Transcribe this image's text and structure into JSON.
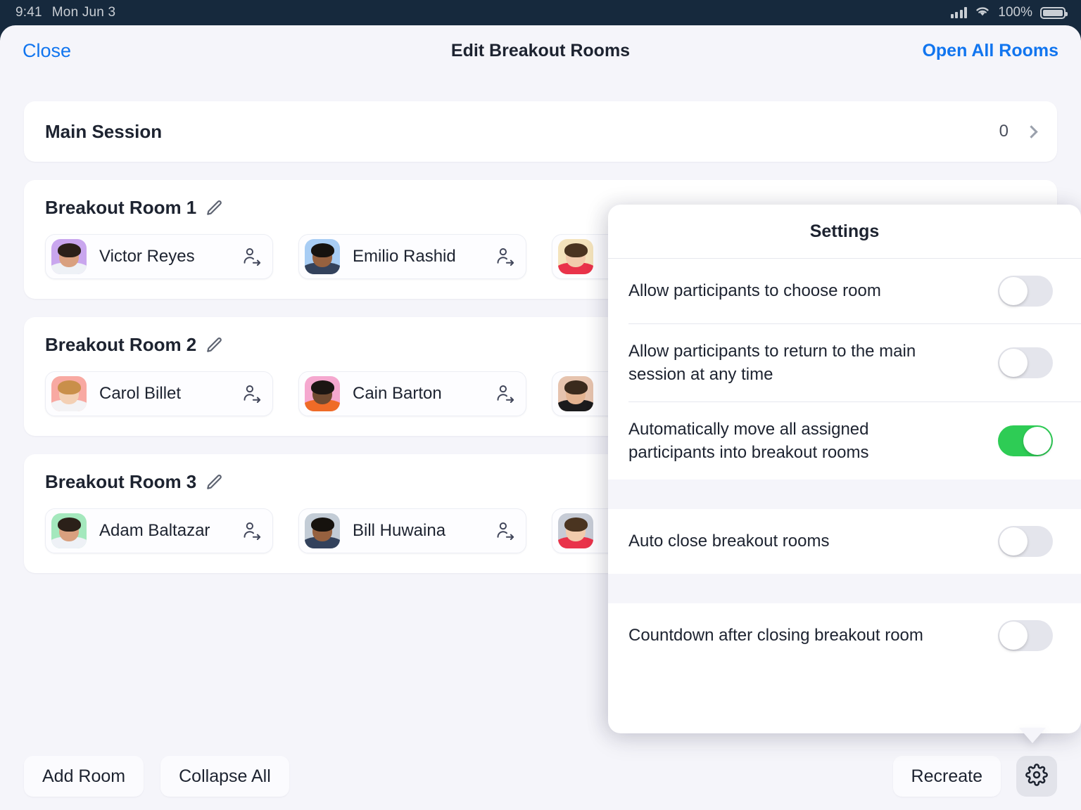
{
  "status_bar": {
    "time": "9:41",
    "date": "Mon Jun 3",
    "battery_text": "100%",
    "signal_icon": "cellular-signal-icon",
    "wifi_icon": "wifi-icon",
    "battery_icon": "battery-icon"
  },
  "nav": {
    "close_label": "Close",
    "title": "Edit Breakout Rooms",
    "action_label": "Open All Rooms"
  },
  "main_session": {
    "title": "Main Session",
    "count": "0",
    "chevron_icon": "chevron-right-icon"
  },
  "rooms": [
    {
      "title": "Breakout Room 1",
      "edit_icon": "pencil-icon",
      "participants": [
        {
          "name": "Victor Reyes",
          "avatar_bg": "#c9a6ee",
          "move_icon": "move-participant-icon"
        },
        {
          "name": "Emilio Rashid",
          "avatar_bg": "#a8cdf4",
          "move_icon": "move-participant-icon"
        },
        {
          "name": "",
          "avatar_bg": "#f4e3bc",
          "move_icon": "move-participant-icon"
        }
      ]
    },
    {
      "title": "Breakout Room 2",
      "edit_icon": "pencil-icon",
      "participants": [
        {
          "name": "Carol Billet",
          "avatar_bg": "#f8a9a2",
          "move_icon": "move-participant-icon"
        },
        {
          "name": "Cain Barton",
          "avatar_bg": "#f5a8cf",
          "move_icon": "move-participant-icon"
        },
        {
          "name": "",
          "avatar_bg": "#e6c3ae",
          "move_icon": "move-participant-icon"
        }
      ]
    },
    {
      "title": "Breakout Room 3",
      "edit_icon": "pencil-icon",
      "participants": [
        {
          "name": "Adam Baltazar",
          "avatar_bg": "#a4e8bd",
          "move_icon": "move-participant-icon"
        },
        {
          "name": "Bill Huwaina",
          "avatar_bg": "#c3ccd6",
          "move_icon": "move-participant-icon"
        },
        {
          "name": "",
          "avatar_bg": "#c7ccd6",
          "move_icon": "move-participant-icon"
        }
      ]
    }
  ],
  "toolbar": {
    "add_room_label": "Add Room",
    "collapse_all_label": "Collapse All",
    "recreate_label": "Recreate",
    "gear_icon": "gear-icon"
  },
  "settings_popover": {
    "title": "Settings",
    "groups": [
      {
        "rows": [
          {
            "label": "Allow participants to choose room",
            "on": false
          },
          {
            "label": "Allow participants to return to the main session at any time",
            "on": false
          },
          {
            "label": "Automatically move all assigned participants into breakout rooms",
            "on": true
          }
        ]
      },
      {
        "rows": [
          {
            "label": "Auto close breakout rooms",
            "on": false
          }
        ]
      },
      {
        "rows": [
          {
            "label": "Countdown after closing breakout room",
            "on": false
          }
        ]
      }
    ]
  },
  "colors": {
    "accent_blue": "#1175ef",
    "toggle_on_green": "#2ecc55",
    "toggle_off_grey": "#e4e5ec",
    "page_bg": "#f5f5fa",
    "card_bg": "#ffffff",
    "status_bar_bg": "#16293d"
  }
}
